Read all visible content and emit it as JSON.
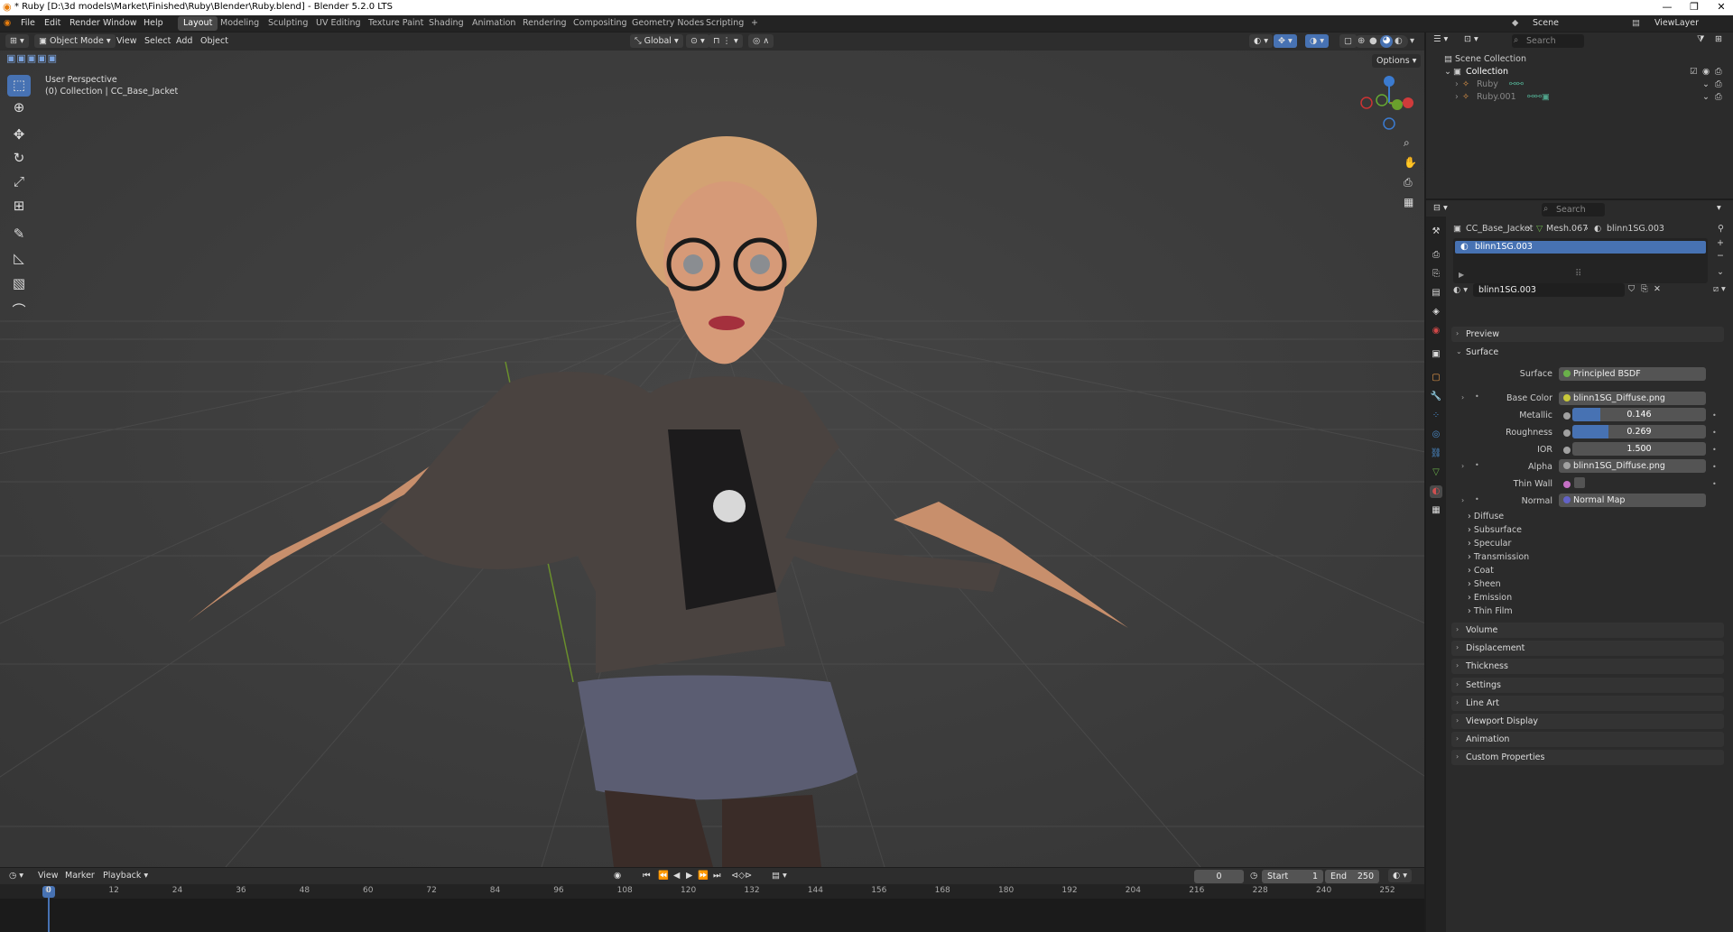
{
  "titlebar": {
    "title": "* Ruby [D:\\3d models\\Market\\Finished\\Ruby\\Blender\\Ruby.blend] - Blender 5.2.0 LTS",
    "minimize": "—",
    "maximize": "❐",
    "close": "✕"
  },
  "menu": {
    "file": "File",
    "edit": "Edit",
    "render": "Render",
    "window": "Window",
    "help": "Help"
  },
  "workspaces": [
    "Layout",
    "Modeling",
    "Sculpting",
    "UV Editing",
    "Texture Paint",
    "Shading",
    "Animation",
    "Rendering",
    "Compositing",
    "Geometry Nodes",
    "Scripting",
    "+"
  ],
  "scene": {
    "scene_name": "Scene",
    "view_layer": "ViewLayer"
  },
  "viewport_header": {
    "mode": "Object Mode",
    "view": "View",
    "select": "Select",
    "add": "Add",
    "object": "Object",
    "orientation": "Global",
    "options": "Options"
  },
  "viewport": {
    "perspective": "User Perspective",
    "collection_info": "(0) Collection | CC_Base_Jacket",
    "gizmo_x": "X",
    "gizmo_y": "Y",
    "gizmo_z": "Z"
  },
  "outliner": {
    "search_placeholder": "Search",
    "root": "Scene Collection",
    "collection": "Collection",
    "items": [
      "Ruby",
      "Ruby.001"
    ]
  },
  "properties": {
    "search_placeholder": "Search",
    "breadcrumb": [
      "CC_Base_Jacket",
      "Mesh.067",
      "blinn1SG.003"
    ],
    "slot_selected": "blinn1SG.003",
    "material_name": "blinn1SG.003",
    "panels_top": [
      "Preview",
      "Surface"
    ],
    "surface": {
      "surface_label": "Surface",
      "surface_value": "Principled BSDF",
      "base_color_label": "Base Color",
      "base_color_value": "blinn1SG_Diffuse.png",
      "metallic_label": "Metallic",
      "metallic_value": "0.146",
      "metallic_fraction": 0.146,
      "roughness_label": "Roughness",
      "roughness_value": "0.269",
      "roughness_fraction": 0.269,
      "ior_label": "IOR",
      "ior_value": "1.500",
      "alpha_label": "Alpha",
      "alpha_value": "blinn1SG_Diffuse.png",
      "thin_wall_label": "Thin Wall",
      "normal_label": "Normal",
      "normal_value": "Normal Map"
    },
    "subpanels": [
      "Diffuse",
      "Subsurface",
      "Specular",
      "Transmission",
      "Coat",
      "Sheen",
      "Emission",
      "Thin Film"
    ],
    "panels_bottom": [
      "Volume",
      "Displacement",
      "Thickness",
      "Settings",
      "Line Art",
      "Viewport Display",
      "Animation",
      "Custom Properties"
    ]
  },
  "timeline": {
    "view": "View",
    "marker": "Marker",
    "playback": "Playback",
    "current_frame": "0",
    "start_label": "Start",
    "start_value": "1",
    "end_label": "End",
    "end_value": "250",
    "ticks": [
      "0",
      "12",
      "24",
      "36",
      "48",
      "60",
      "72",
      "84",
      "96",
      "108",
      "120",
      "132",
      "144",
      "156",
      "168",
      "180",
      "192",
      "204",
      "216",
      "228",
      "240",
      "252"
    ]
  },
  "colors": {
    "accent": "#4772b3",
    "viewport_bg": "#3f3f3f",
    "panel_bg": "#2b2b2b"
  }
}
